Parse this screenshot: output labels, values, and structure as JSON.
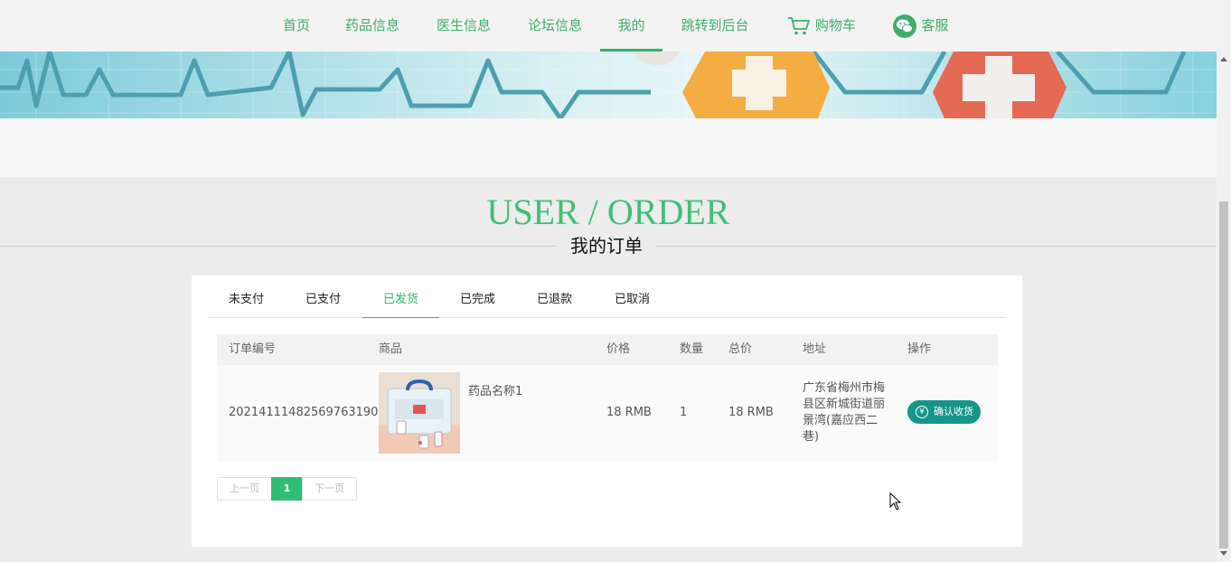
{
  "nav": {
    "items": [
      {
        "label": "首页"
      },
      {
        "label": "药品信息"
      },
      {
        "label": "医生信息"
      },
      {
        "label": "论坛信息"
      },
      {
        "label": "我的"
      },
      {
        "label": "跳转到后台"
      },
      {
        "label": "购物车",
        "icon": "cart-icon"
      },
      {
        "label": "客服",
        "icon": "wechat-icon"
      }
    ],
    "active_label": "我的"
  },
  "colors": {
    "accent": "#2fb36c",
    "title": "#3fbf76",
    "confirm": "#16958a"
  },
  "section": {
    "title_en": "USER / ORDER",
    "title_cn": "我的订单"
  },
  "tabs": [
    {
      "label": "未支付"
    },
    {
      "label": "已支付"
    },
    {
      "label": "已发货"
    },
    {
      "label": "已完成"
    },
    {
      "label": "已退款"
    },
    {
      "label": "已取消"
    }
  ],
  "active_tab": "已发货",
  "table": {
    "headers": [
      "订单编号",
      "商品",
      "价格",
      "数量",
      "总价",
      "地址",
      "操作"
    ],
    "rows": [
      {
        "order_no": "20214111482569763190",
        "product_name": "药品名称1",
        "price": "18 RMB",
        "quantity": "1",
        "total": "18 RMB",
        "address": "广东省梅州市梅县区新城街道丽景湾(嘉应西二巷)",
        "action": "确认收货",
        "action_icon": "yen-icon",
        "action_icon_glyph": "¥"
      }
    ]
  },
  "pagination": {
    "prev": "上一页",
    "current": "1",
    "next": "下一页"
  }
}
